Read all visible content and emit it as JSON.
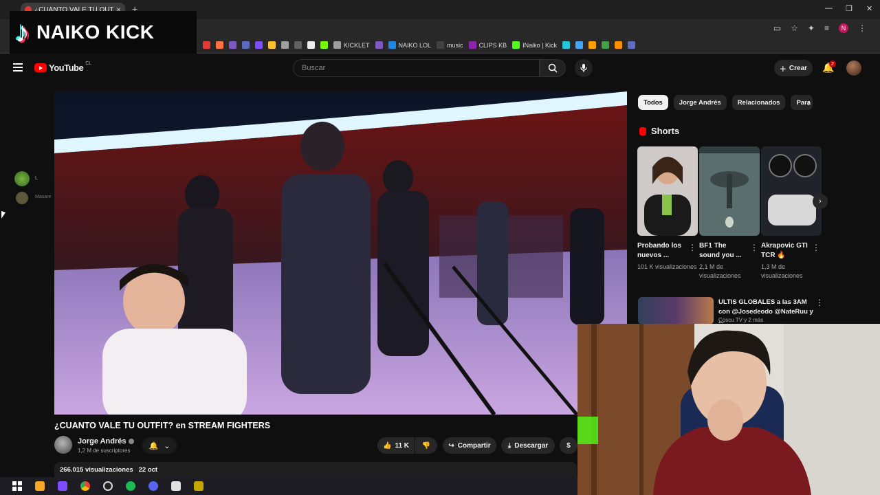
{
  "browser": {
    "tab_title": "¿CUANTO VALE TU OUTFIT",
    "tab_close": "×",
    "new_tab": "+",
    "window_controls": [
      "—",
      "❐",
      "✕"
    ],
    "bookmarks": [
      "KICKLET",
      "NAIKO LOL",
      "music",
      "CLIPS KB",
      "INaiko | Kick"
    ],
    "profile_initial": "N"
  },
  "overlay": {
    "tiktok_handle": "NAIKO KICK",
    "tiktok_logo": "♪"
  },
  "youtube": {
    "brand": "YouTube",
    "region": "CL",
    "search_placeholder": "Buscar",
    "create_label": "Crear",
    "notifications_count": "2"
  },
  "video": {
    "title": "¿CUANTO VALE TU OUTFIT? en STREAM FIGHTERS",
    "channel_name": "Jorge Andrés",
    "subscribers": "1,2 M de suscriptores",
    "likes": "11 K",
    "share_label": "Compartir",
    "download_label": "Descargar",
    "views": "266.015 visualizaciones",
    "date": "22 oct"
  },
  "sidebar_widget": {
    "user1": "L",
    "user2": "Masare"
  },
  "chips": [
    "Todos",
    "Jorge Andrés",
    "Relacionados",
    "Para"
  ],
  "shorts": {
    "heading": "Shorts",
    "items": [
      {
        "title": "Probando los nuevos ...",
        "views": "101 K visualizaciones"
      },
      {
        "title": "BF1 The sound you ...",
        "views": "2,1 M de visualizaciones"
      },
      {
        "title": "Akrapovic GTI TCR 🔥",
        "views": "1,3 M de visualizaciones"
      }
    ]
  },
  "recommended": {
    "title": "ULTIS GLOBALES a las 3AM con @Josedeodo @NateRuu y ...",
    "meta": "Coscu TV y 2 más"
  },
  "colors": {
    "youtube_red": "#ff0000",
    "background": "#0f0f0f",
    "chip_active": "#f1f1f1"
  }
}
